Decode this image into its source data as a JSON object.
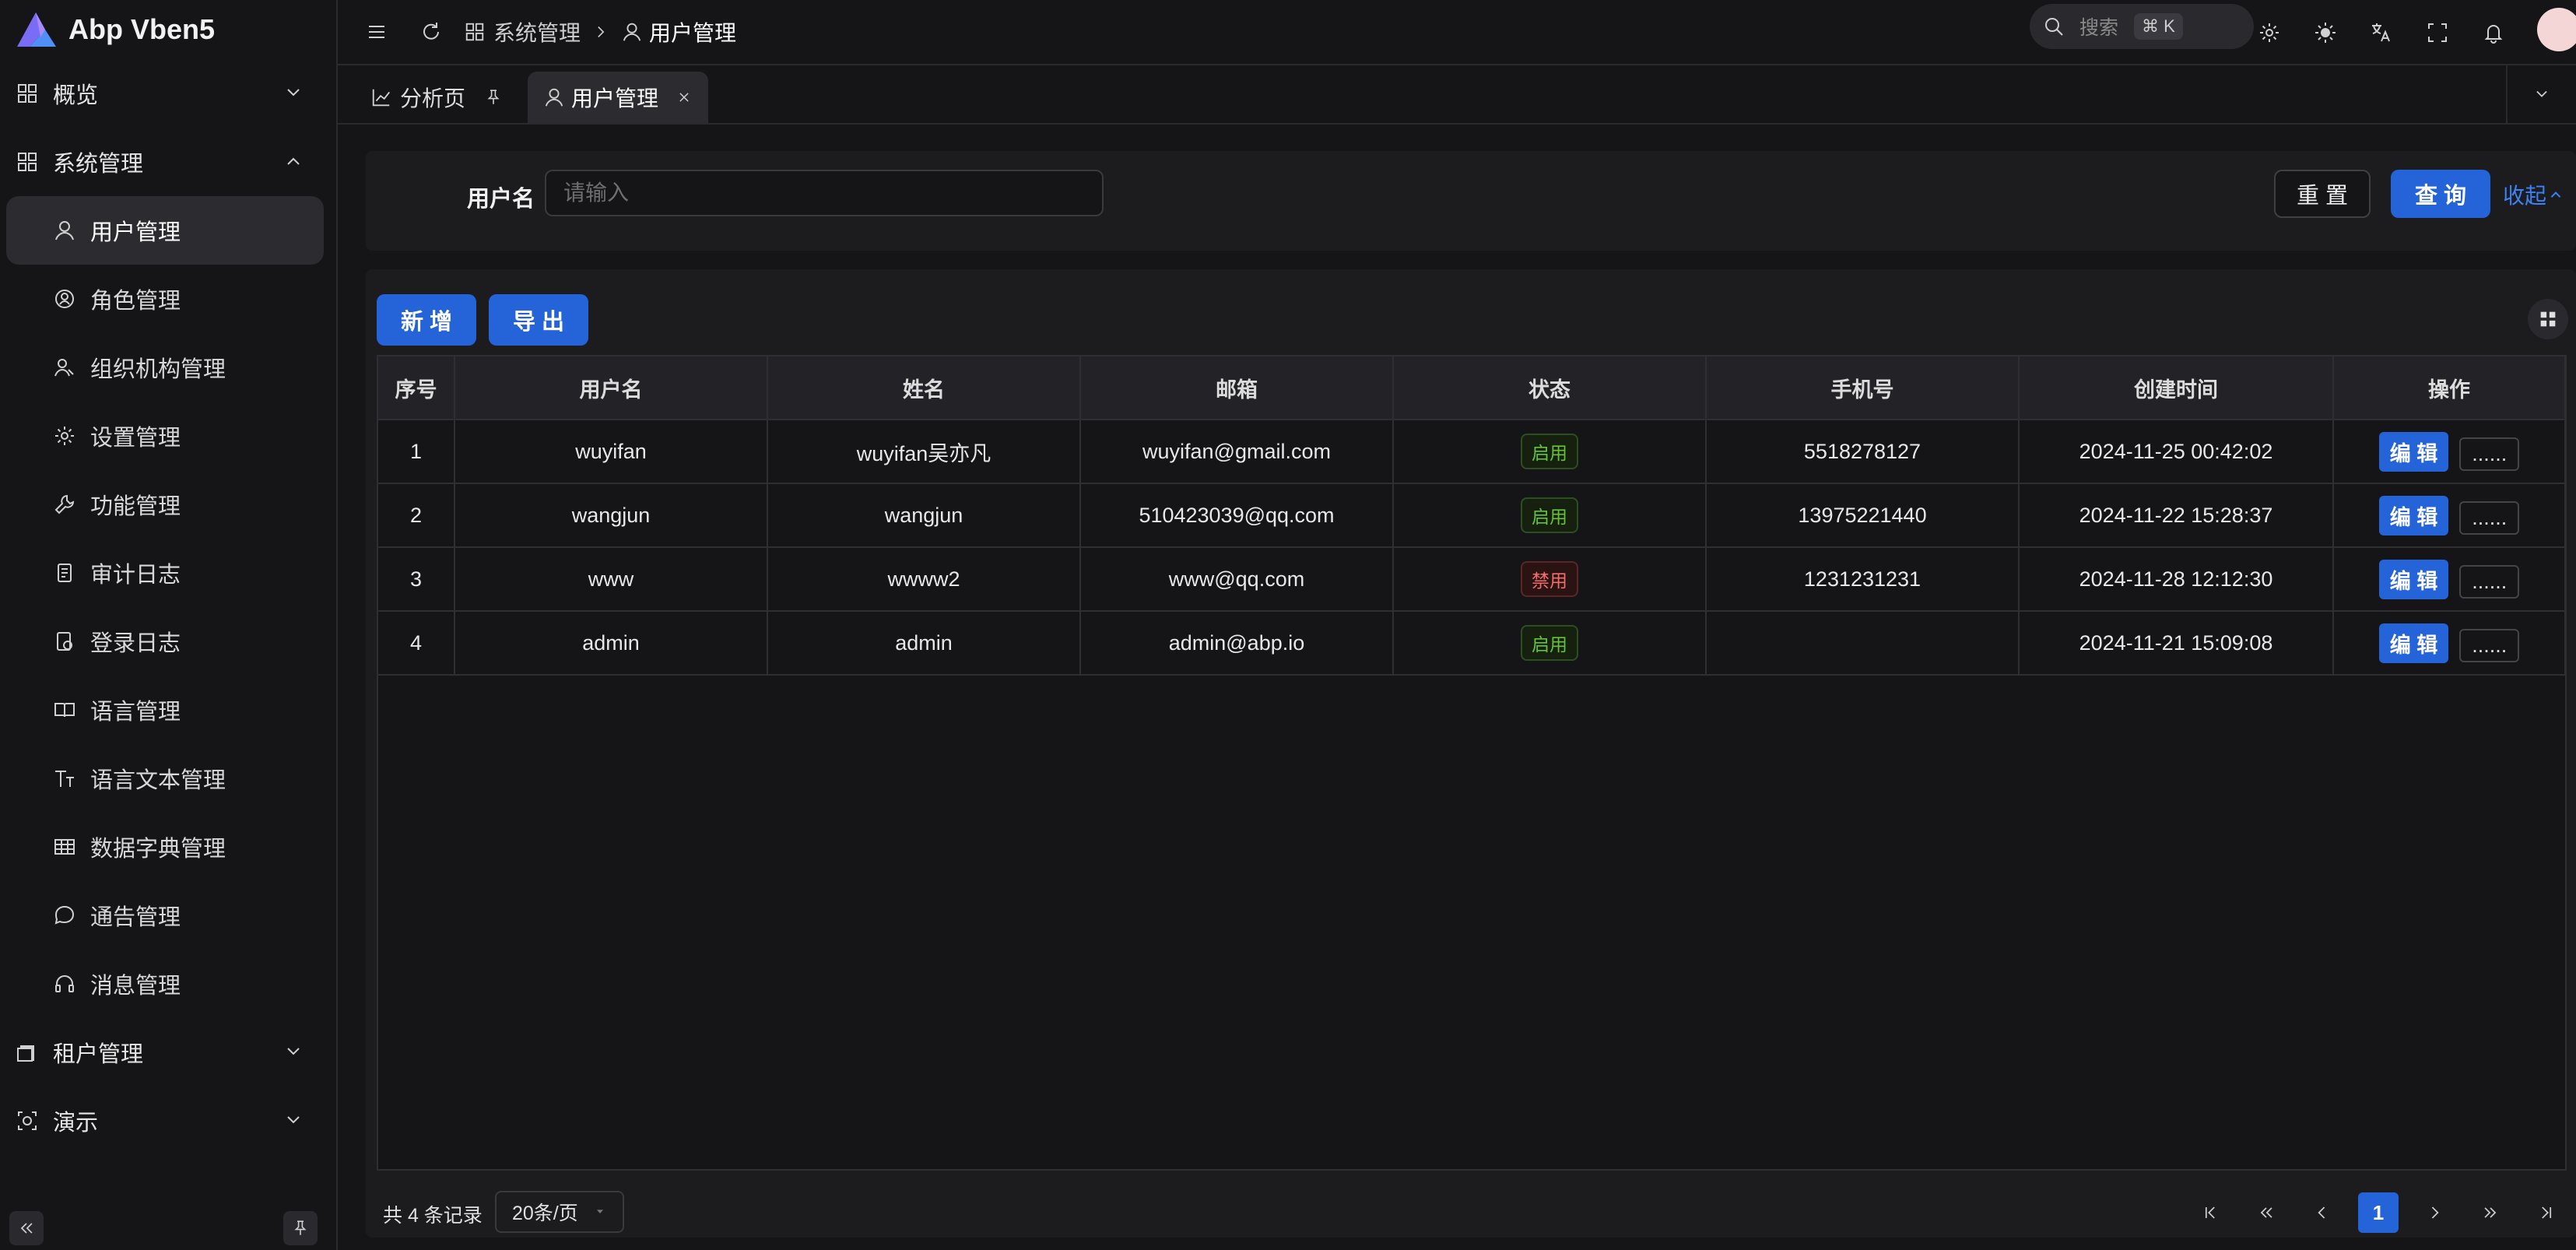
{
  "app": {
    "title": "Abp Vben5"
  },
  "sidebar": {
    "groups": [
      {
        "label": "概览"
      },
      {
        "label": "系统管理"
      },
      {
        "label": "租户管理"
      },
      {
        "label": "演示"
      }
    ],
    "items": [
      {
        "label": "用户管理",
        "icon": "user-icon"
      },
      {
        "label": "角色管理",
        "icon": "role-icon"
      },
      {
        "label": "组织机构管理",
        "icon": "org-icon"
      },
      {
        "label": "设置管理",
        "icon": "gear-icon"
      },
      {
        "label": "功能管理",
        "icon": "wrench-icon"
      },
      {
        "label": "审计日志",
        "icon": "audit-icon"
      },
      {
        "label": "登录日志",
        "icon": "login-log-icon"
      },
      {
        "label": "语言管理",
        "icon": "book-icon"
      },
      {
        "label": "语言文本管理",
        "icon": "text-icon"
      },
      {
        "label": "数据字典管理",
        "icon": "table-icon"
      },
      {
        "label": "通告管理",
        "icon": "chat-icon"
      },
      {
        "label": "消息管理",
        "icon": "headset-icon"
      }
    ]
  },
  "header": {
    "breadcrumb": [
      "系统管理",
      "用户管理"
    ],
    "search_label": "搜索",
    "search_shortcut": "⌘ K"
  },
  "tabs": [
    {
      "label": "分析页"
    },
    {
      "label": "用户管理"
    }
  ],
  "filter": {
    "username_label": "用户名",
    "username_placeholder": "请输入",
    "reset_label": "重 置",
    "query_label": "查 询",
    "collapse_label": "收起"
  },
  "toolbar": {
    "add_label": "新 增",
    "export_label": "导 出"
  },
  "table": {
    "columns": [
      "序号",
      "用户名",
      "姓名",
      "邮箱",
      "状态",
      "手机号",
      "创建时间",
      "操作"
    ],
    "rows": [
      {
        "index": "1",
        "username": "wuyifan",
        "name": "wuyifan吴亦凡",
        "email": "wuyifan@gmail.com",
        "status": "启用",
        "phone": "5518278127",
        "created": "2024-11-25 00:42:02"
      },
      {
        "index": "2",
        "username": "wangjun",
        "name": "wangjun",
        "email": "510423039@qq.com",
        "status": "启用",
        "phone": "13975221440",
        "created": "2024-11-22 15:28:37"
      },
      {
        "index": "3",
        "username": "www",
        "name": "wwww2",
        "email": "www@qq.com",
        "status": "禁用",
        "phone": "1231231231",
        "created": "2024-11-28 12:12:30"
      },
      {
        "index": "4",
        "username": "admin",
        "name": "admin",
        "email": "admin@abp.io",
        "status": "启用",
        "phone": "",
        "created": "2024-11-21 15:09:08"
      }
    ],
    "edit_label": "编 辑",
    "more_label": "......"
  },
  "pagination": {
    "total_text": "共 4 条记录",
    "page_size": "20条/页",
    "current_page": "1"
  },
  "colors": {
    "primary": "#2563d9",
    "success": "#67c23a",
    "danger": "#f56c6c",
    "background": "#151518"
  }
}
